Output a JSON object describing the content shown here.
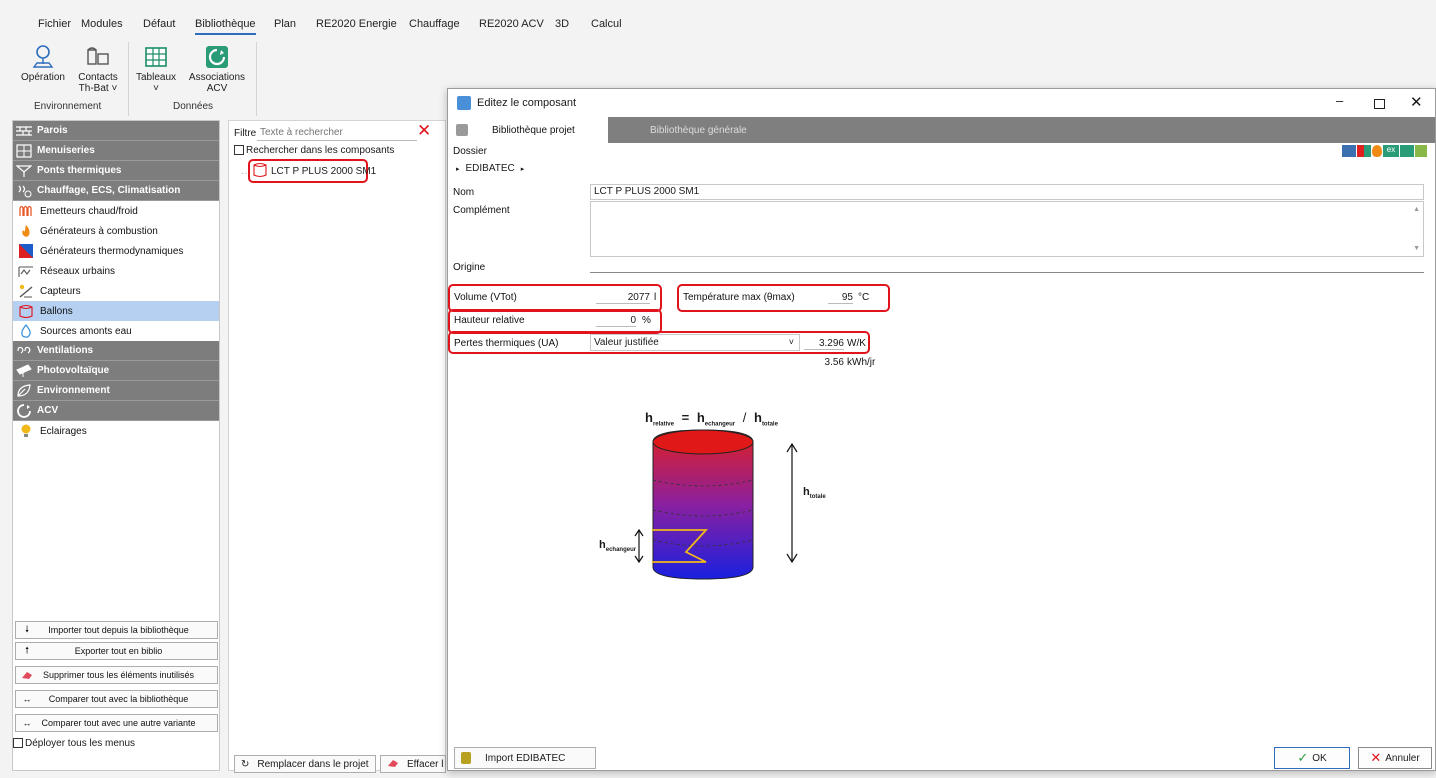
{
  "menu": {
    "items": [
      "Fichier",
      "Modules",
      "Défaut",
      "Bibliothèque",
      "Plan",
      "RE2020 Energie",
      "Chauffage",
      "RE2020 ACV",
      "3D",
      "Calcul"
    ],
    "active": "Bibliothèque"
  },
  "ribbon": {
    "operation": "Opération",
    "contacts_line1": "Contacts",
    "contacts_line2": "Th-Bat ˅",
    "tableaux": "Tableaux",
    "tableaux_arrow": "˅",
    "associations_line1": "Associations",
    "associations_line2": "ACV",
    "group_environnement": "Environnement",
    "group_donnees": "Données"
  },
  "left": {
    "categories": [
      "Parois",
      "Menuiseries",
      "Ponts thermiques",
      "Chauffage, ECS, Climatisation"
    ],
    "items": [
      "Emetteurs chaud/froid",
      "Générateurs à combustion",
      "Générateurs thermodynamiques",
      "Réseaux urbains",
      "Capteurs",
      "Ballons",
      "Sources amonts eau"
    ],
    "categories2": [
      "Ventilations",
      "Photovoltaïque",
      "Environnement",
      "ACV"
    ],
    "eclairages": "Eclairages",
    "buttons": [
      "Importer tout depuis la bibliothèque",
      "Exporter tout en biblio",
      "Supprimer tous les éléments inutilisés",
      "Comparer tout avec la bibliothèque",
      "Comparer tout avec une autre variante"
    ],
    "deploy": "Déployer tous les menus"
  },
  "middle": {
    "filter_label": "Filtre",
    "filter_placeholder": "Texte à rechercher",
    "search_in_components": "Rechercher dans les composants",
    "component": "LCT P PLUS 2000 SM1",
    "replace_button": "Remplacer dans le projet",
    "delete_button": "Effacer l"
  },
  "dialog": {
    "title": "Editez le composant",
    "tab_project": "Bibliothèque projet",
    "tab_general": "Bibliothèque générale",
    "dossier_label": "Dossier",
    "dossier_value": "EDIBATEC",
    "nom_label": "Nom",
    "nom_value": "LCT P PLUS 2000 SM1",
    "complement_label": "Complément",
    "origine_label": "Origine",
    "volume_label": "Volume (VTot)",
    "volume_value": "2077",
    "volume_unit": "l",
    "temp_label": "Température max (θmax)",
    "temp_value": "95",
    "temp_unit": "°C",
    "hauteur_label": "Hauteur relative",
    "hauteur_value": "0",
    "hauteur_unit": "%",
    "pertes_label": "Pertes thermiques (UA)",
    "pertes_select": "Valeur justifiée",
    "pertes_value": "3.296",
    "pertes_unit": "W/K",
    "pertes_value2": "3.56",
    "pertes_unit2": "kWh/jr",
    "import_button": "Import EDIBATEC",
    "ok_button": "OK",
    "cancel_button": "Annuler"
  },
  "diagram": {
    "h": "h",
    "relative": "relative",
    "echangeur": "echangeur",
    "totale": "totale"
  },
  "colors": {
    "category_bg": "#7d7d7d",
    "selected_bg": "#b5d0f0",
    "highlight_red": "#e0141c",
    "accent_blue": "#2f6dbb"
  }
}
